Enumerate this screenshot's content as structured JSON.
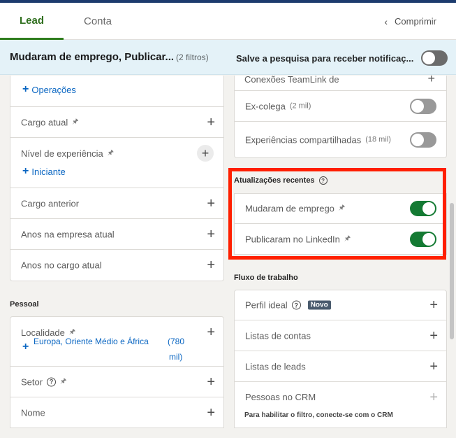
{
  "tabs": [
    {
      "label": "Lead",
      "active": true
    },
    {
      "label": "Conta",
      "active": false
    }
  ],
  "collapse": {
    "label": "Comprimir"
  },
  "search": {
    "title": "Mudaram de emprego, Publicar...",
    "filter_count": "(2 filtros)",
    "save_label": "Salve a pesquisa para receber notificaç...",
    "save_toggle_on": false
  },
  "left": {
    "tag_operacoes": "Operações",
    "cargo_atual": "Cargo atual",
    "nivel_experiencia": "Nível de experiência",
    "tag_iniciante": "Iniciante",
    "cargo_anterior": "Cargo anterior",
    "anos_empresa": "Anos na empresa atual",
    "anos_cargo": "Anos no cargo atual",
    "section_pessoal": "Pessoal",
    "localidade": "Localidade",
    "tag_europa": "Europa, Oriente Médio e África",
    "tag_europa_count_1": "(780",
    "tag_europa_count_2": "mil)",
    "setor": "Setor",
    "nome": "Nome"
  },
  "right": {
    "conexoes": "Conexões TeamLink de",
    "ex_colega": "Ex-colega",
    "ex_colega_count": "(2 mil)",
    "experiencias": "Experiências compartilhadas",
    "experiencias_count": "(18 mil)",
    "section_atualizacoes": "Atualizações recentes",
    "mudaram": "Mudaram de emprego",
    "publicaram": "Publicaram no LinkedIn",
    "section_fluxo": "Fluxo de trabalho",
    "perfil_ideal": "Perfil ideal",
    "badge_novo": "Novo",
    "listas_contas": "Listas de contas",
    "listas_leads": "Listas de leads",
    "pessoas_crm": "Pessoas no CRM",
    "crm_hint": "Para habilitar o filtro, conecte-se com o CRM"
  },
  "colors": {
    "accent_green": "#147a33",
    "tab_green": "#2f6f1e",
    "link_blue": "#0a66c2",
    "highlight_red": "#ff1f00"
  }
}
